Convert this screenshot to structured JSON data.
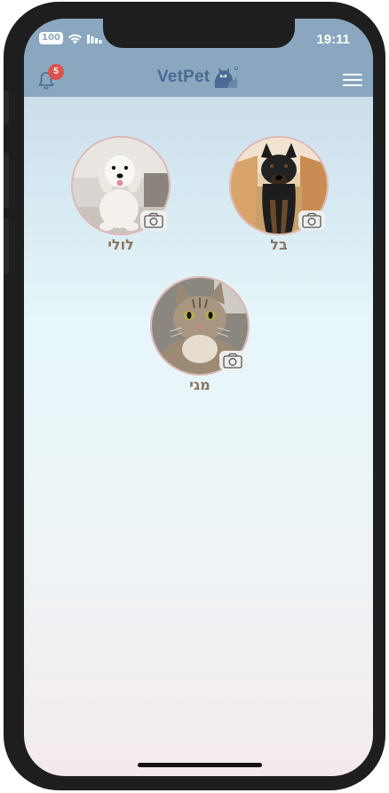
{
  "status_bar": {
    "battery": "100",
    "time": "19:11"
  },
  "header": {
    "notification_count": "5",
    "logo_text": "VetPet"
  },
  "pets": [
    {
      "name": "בל",
      "photo": "black german shepherd puppy in cardboard box"
    },
    {
      "name": "לולי",
      "photo": "white maltese dog"
    },
    {
      "name": "מגי",
      "photo": "tabby cat"
    }
  ],
  "colors": {
    "header": "#8ba7c0",
    "badge": "#d9544f",
    "logo": "#4a6a93",
    "pet_name": "#8a7560",
    "avatar_border": "#e0b7b5"
  }
}
